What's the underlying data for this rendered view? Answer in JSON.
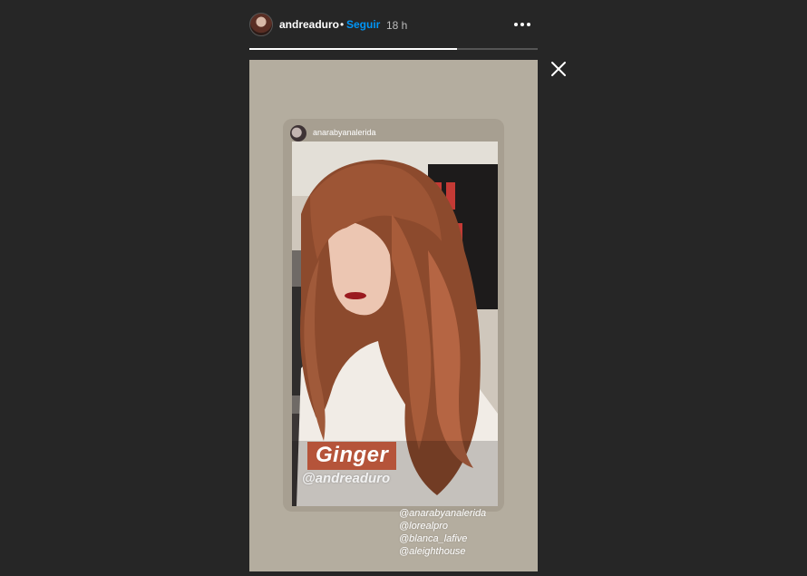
{
  "header": {
    "username": "andreaduro",
    "separator": "•",
    "follow_label": "Seguir",
    "time": "18 h",
    "more_icon": "more-horizontal-icon"
  },
  "progress": {
    "fraction": 0.72
  },
  "close_icon": "close-icon",
  "story": {
    "shared_post": {
      "username": "anarabyanalerida"
    },
    "sticker_text": "Ginger",
    "mention": "@andreaduro",
    "tags": [
      "@anarabyanalerida",
      "@lorealpro",
      "@blanca_lafive",
      "@aleighthouse"
    ]
  },
  "colors": {
    "background": "#262626",
    "story_bg": "#b4ad9f",
    "follow_blue": "#0095f6",
    "sticker": "#b5543a"
  }
}
